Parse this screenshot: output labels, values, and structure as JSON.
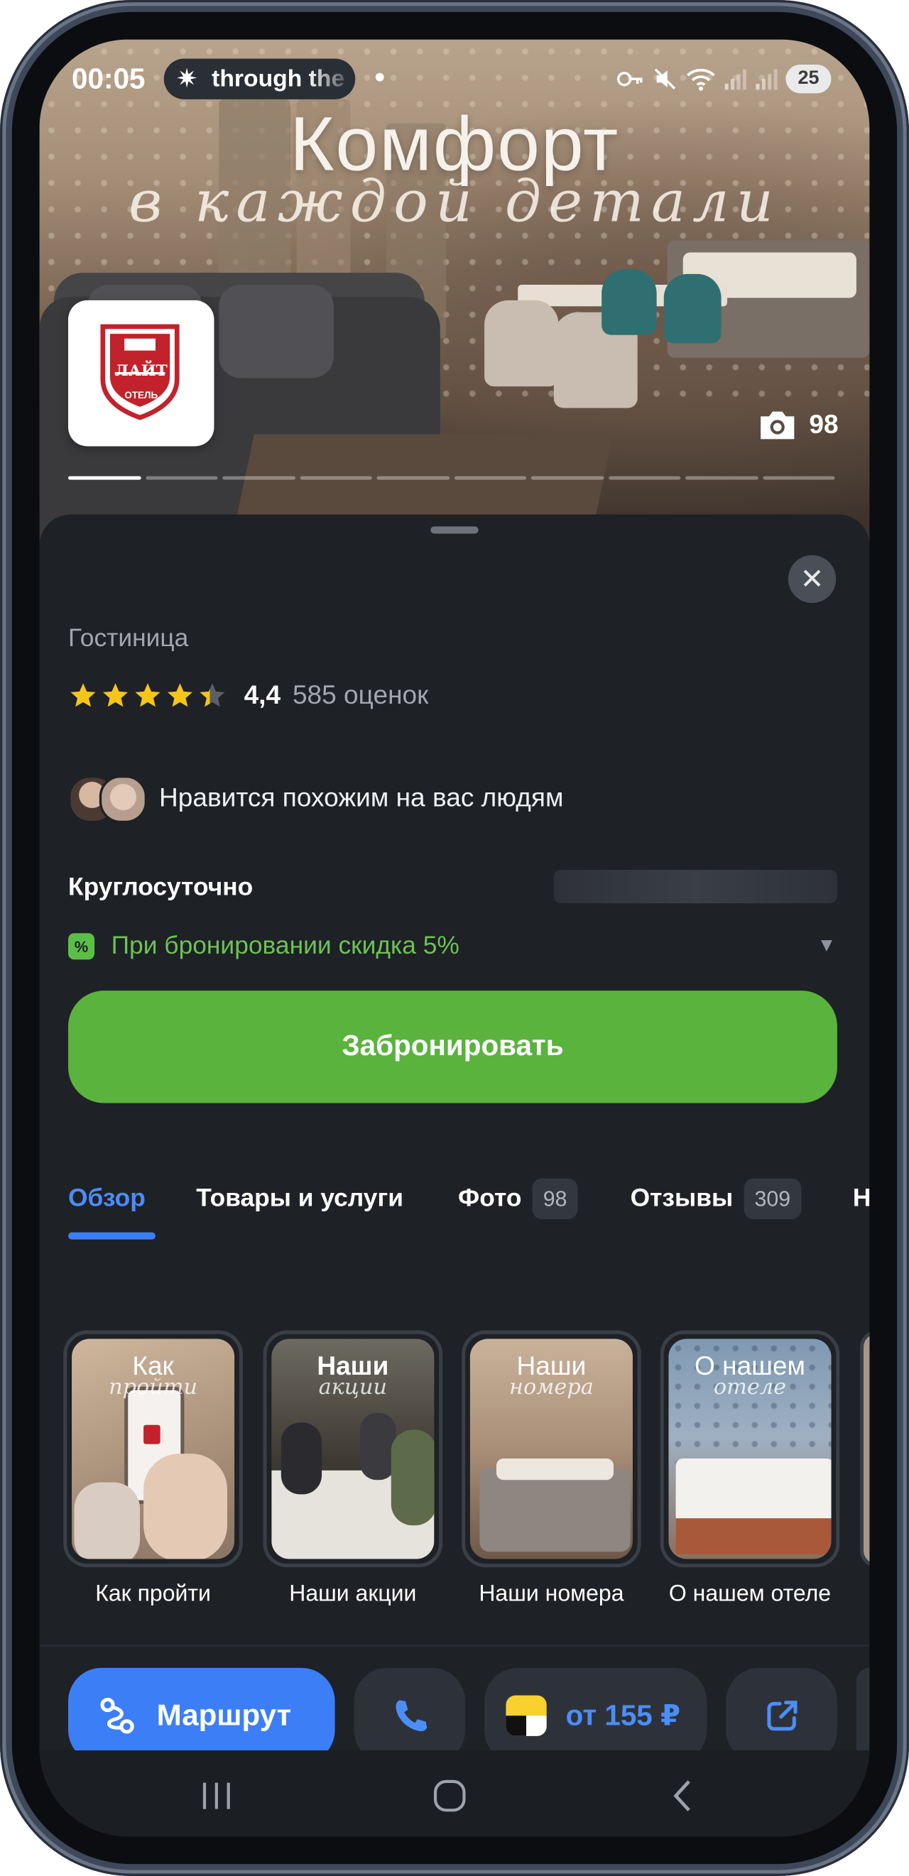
{
  "status_bar": {
    "time": "00:05",
    "media_text": "through the",
    "battery": "25",
    "icons": [
      "key-icon",
      "mute-icon",
      "wifi-icon",
      "signal-icon",
      "signal-icon",
      "battery-icon"
    ]
  },
  "hero": {
    "title": "Комфорт",
    "script": "в каждой детали",
    "photo_count": "98",
    "logo": {
      "name": "ЛАЙТ",
      "sub": "ОТЕЛЬ"
    },
    "pages_total": 10,
    "page_active": 1
  },
  "place": {
    "category": "Гостиница",
    "rating": "4,4",
    "rating_value": 4.4,
    "rating_count": "585 оценок",
    "social_proof": "Нравится похожим на вас людям",
    "hours": "Круглосуточно",
    "promo": "При бронировании скидка 5%",
    "book_button": "Забронировать"
  },
  "tabs": [
    {
      "label": "Обзор",
      "active": true
    },
    {
      "label": "Товары и услуги"
    },
    {
      "label": "Фото",
      "badge": "98"
    },
    {
      "label": "Отзывы",
      "badge": "309"
    },
    {
      "label": "Н"
    }
  ],
  "stories": [
    {
      "label": "Как пройти",
      "title": "Как",
      "script": "пройти"
    },
    {
      "label": "Наши акции",
      "title": "Наши",
      "script": "акции"
    },
    {
      "label": "Наши номера",
      "title": "Наши",
      "script": "номера"
    },
    {
      "label": "О нашем отеле",
      "title": "О нашем",
      "script": "отеле"
    }
  ],
  "actions": {
    "route": "Маршрут",
    "taxi": "от 155 ₽"
  },
  "colors": {
    "accent_blue": "#3c7ef6",
    "book_green": "#5ab33d",
    "promo_green": "#6cc352",
    "star": "#f5c518",
    "sheet_bg": "#1e2126"
  }
}
